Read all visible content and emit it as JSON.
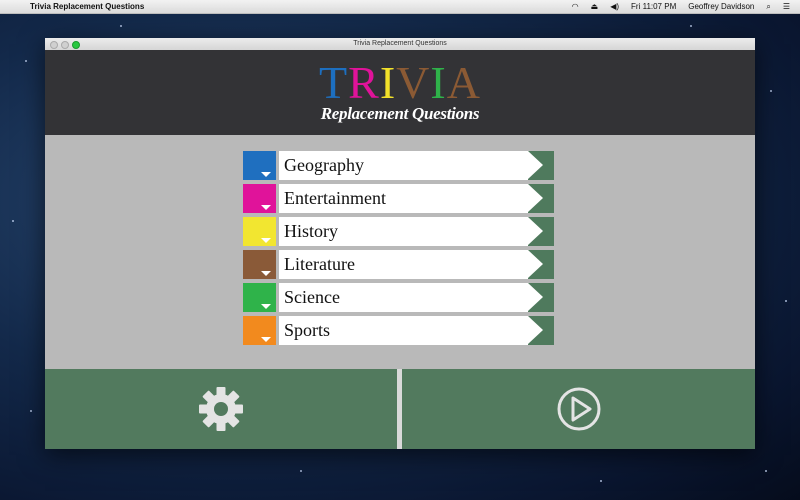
{
  "menubar": {
    "app_name": "Trivia Replacement Questions",
    "datetime": "Fri 11:07 PM",
    "user": "Geoffrey Davidson"
  },
  "window": {
    "title": "Trivia Replacement Questions"
  },
  "header": {
    "logo_letters": [
      {
        "char": "T",
        "color": "#1d6fc0"
      },
      {
        "char": "R",
        "color": "#e0139a"
      },
      {
        "char": "I",
        "color": "#f2e12a"
      },
      {
        "char": "V",
        "color": "#8b5a34"
      },
      {
        "char": "I",
        "color": "#2fb24a"
      },
      {
        "char": "A",
        "color": "#8b5a34"
      }
    ],
    "subtitle": "Replacement Questions"
  },
  "categories": [
    {
      "label": "Geography",
      "color": "#1f6fbf"
    },
    {
      "label": "Entertainment",
      "color": "#e0139a"
    },
    {
      "label": "History",
      "color": "#f2e630"
    },
    {
      "label": "Literature",
      "color": "#8a5a38"
    },
    {
      "label": "Science",
      "color": "#2fb34a"
    },
    {
      "label": "Sports",
      "color": "#f28a1e"
    }
  ],
  "buttons": {
    "settings_icon": "gear-icon",
    "play_icon": "play-circle-icon"
  }
}
